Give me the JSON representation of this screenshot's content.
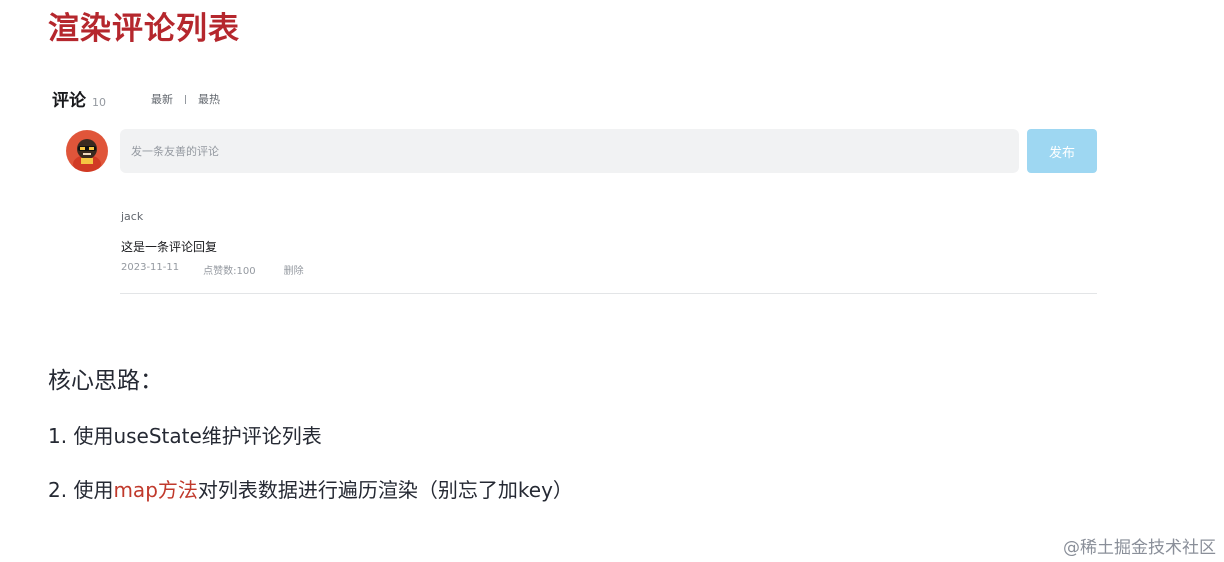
{
  "page": {
    "title": "渲染评论列表"
  },
  "comments": {
    "title": "评论",
    "count": "10",
    "sort_tabs": [
      "最新",
      "最热"
    ],
    "input_placeholder": "发一条友善的评论",
    "publish_label": "发布"
  },
  "reply": {
    "user": "jack",
    "content": "这是一条评论回复",
    "date": "2023-11-11",
    "likes": "点赞数:100",
    "delete_label": "删除"
  },
  "notes": {
    "heading": "核心思路：",
    "item1": "1. 使用useState维护评论列表",
    "item2_prefix": "2. 使用",
    "item2_highlight": "map方法",
    "item2_suffix": "对列表数据进行遍历渲染（别忘了加key）"
  },
  "watermark": "@稀土掘金技术社区",
  "colors": {
    "title": "#b5272d",
    "publish_button": "#9ed7f2",
    "input_bg": "#f1f2f3",
    "highlight": "#c0392b"
  }
}
